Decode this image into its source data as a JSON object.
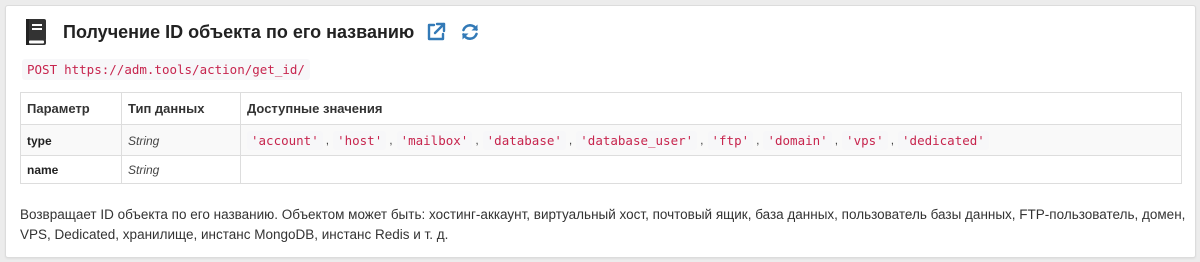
{
  "header": {
    "title": "Получение ID объекта по его названию",
    "icons": [
      "book-icon",
      "external-link-icon",
      "refresh-icon"
    ],
    "accent_color": "#337ab7"
  },
  "endpoint": {
    "method": "POST",
    "url": "https://adm.tools/action/get_id/"
  },
  "table": {
    "headers": {
      "param": "Параметр",
      "type": "Тип данных",
      "values": "Доступные значения"
    },
    "rows": [
      {
        "name": "type",
        "type": "String",
        "values": [
          "'account'",
          "'host'",
          "'mailbox'",
          "'database'",
          "'database_user'",
          "'ftp'",
          "'domain'",
          "'vps'",
          "'dedicated'"
        ]
      },
      {
        "name": "name",
        "type": "String",
        "values": []
      }
    ],
    "separator": ","
  },
  "description": "Возвращает ID объекта по его названию. Объектом может быть: хостинг-аккаунт, виртуальный хост, почтовый ящик, база данных, пользователь базы данных, FTP-пользователь, домен, VPS, Dedicated, хранилище, инстанс MongoDB, инстанс Redis и т. д."
}
